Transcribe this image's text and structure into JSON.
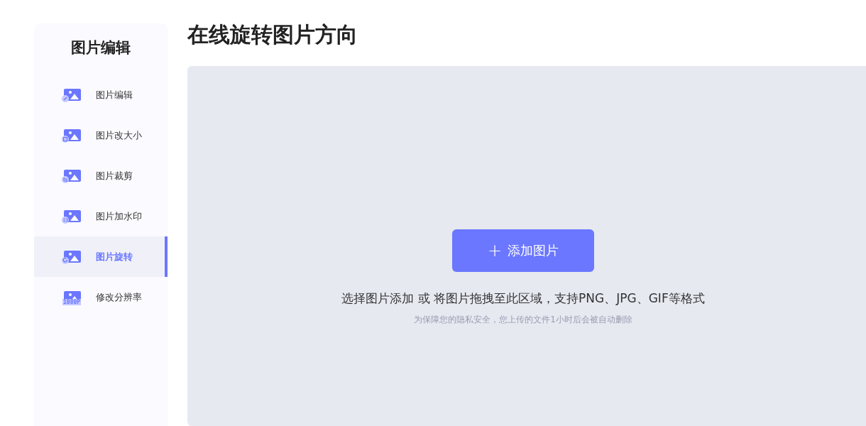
{
  "sidebar": {
    "title": "图片编辑",
    "items": [
      {
        "label": "图片编辑",
        "kind": "edit",
        "selected": false
      },
      {
        "label": "图片改大小",
        "kind": "resize",
        "selected": false
      },
      {
        "label": "图片裁剪",
        "kind": "crop",
        "selected": false
      },
      {
        "label": "图片加水印",
        "kind": "watermark",
        "selected": false
      },
      {
        "label": "图片旋转",
        "kind": "rotate",
        "selected": true
      },
      {
        "label": "修改分辨率",
        "kind": "resolution",
        "icon_text": "1080P",
        "selected": false
      }
    ]
  },
  "main": {
    "title": "在线旋转图片方向",
    "upload": {
      "button_icon": "+",
      "button": "添加图片",
      "hint": "选择图片添加 或 将图片拖拽至此区域，支持PNG、JPG、GIF等格式",
      "note": "为保障您的隐私安全，您上传的文件1小时后会被自动删除"
    }
  }
}
